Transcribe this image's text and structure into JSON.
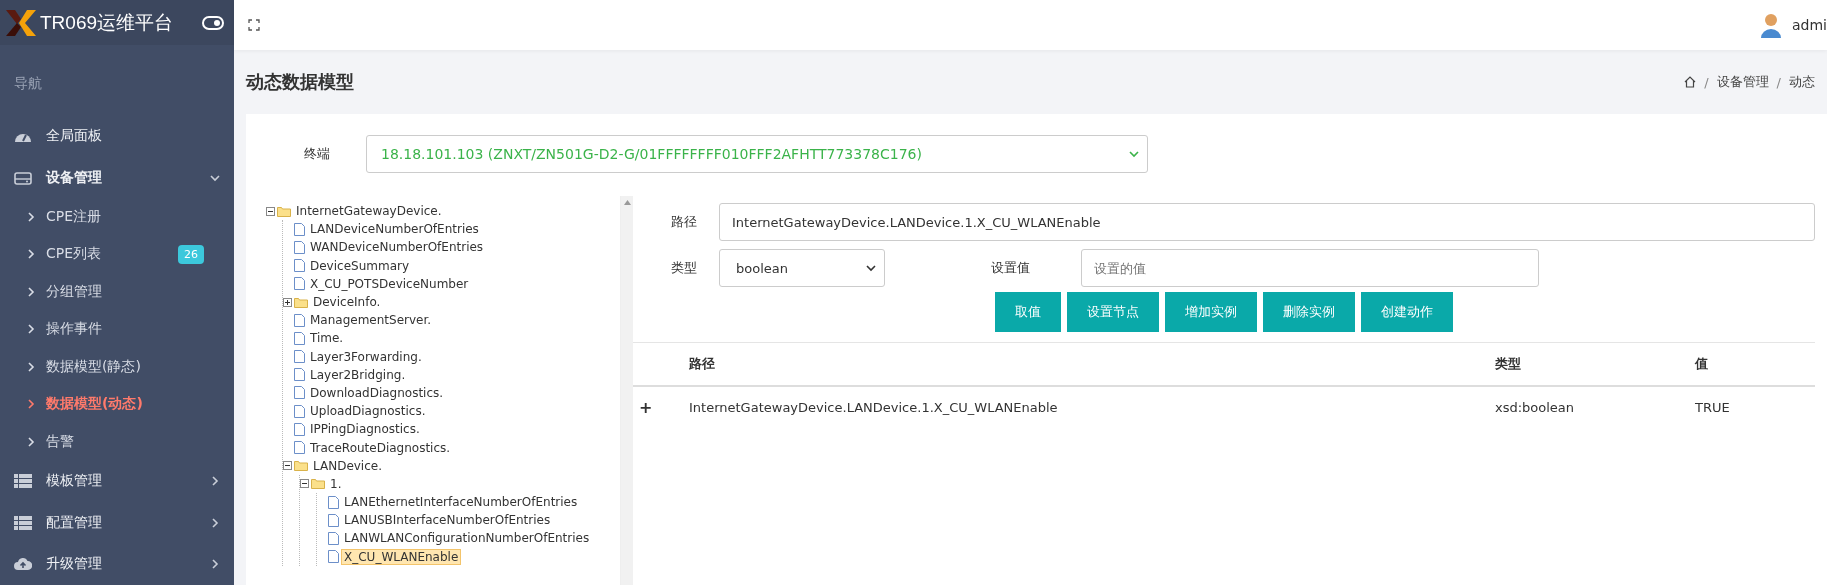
{
  "brand": {
    "title": "TR069运维平台"
  },
  "sidebar": {
    "heading": "导航",
    "items": [
      {
        "label": "全局面板",
        "expanded": false
      },
      {
        "label": "设备管理",
        "expanded": true,
        "children": [
          {
            "label": "CPE注册",
            "selected": false
          },
          {
            "label": "CPE列表",
            "selected": false,
            "badge": "26"
          },
          {
            "label": "分组管理",
            "selected": false
          },
          {
            "label": "操作事件",
            "selected": false
          },
          {
            "label": "数据模型(静态)",
            "selected": false
          },
          {
            "label": "数据模型(动态)",
            "selected": true
          },
          {
            "label": "告警",
            "selected": false
          }
        ]
      },
      {
        "label": "模板管理",
        "expanded": false
      },
      {
        "label": "配置管理",
        "expanded": false
      },
      {
        "label": "升级管理",
        "expanded": false
      }
    ]
  },
  "header": {
    "user": "admi"
  },
  "page": {
    "title": "动态数据模型",
    "breadcrumb_separator": "/",
    "breadcrumb": [
      "设备管理",
      "动态"
    ]
  },
  "terminal": {
    "label": "终端",
    "value": "18.18.101.103 (ZNXT/ZN501G-D2-G/01FFFFFFFF010FFF2AFHTT773378C176)"
  },
  "tree": [
    {
      "label": "InternetGatewayDevice.",
      "kind": "folder",
      "expanded": true,
      "selected": false,
      "children": [
        {
          "label": "LANDeviceNumberOfEntries",
          "kind": "file",
          "selected": false
        },
        {
          "label": "WANDeviceNumberOfEntries",
          "kind": "file",
          "selected": false
        },
        {
          "label": "DeviceSummary",
          "kind": "file",
          "selected": false
        },
        {
          "label": "X_CU_POTSDeviceNumber",
          "kind": "file",
          "selected": false
        },
        {
          "label": "DeviceInfo.",
          "kind": "folder",
          "expanded": false,
          "selected": false
        },
        {
          "label": "ManagementServer.",
          "kind": "file",
          "selected": false
        },
        {
          "label": "Time.",
          "kind": "file",
          "selected": false
        },
        {
          "label": "Layer3Forwarding.",
          "kind": "file",
          "selected": false
        },
        {
          "label": "Layer2Bridging.",
          "kind": "file",
          "selected": false
        },
        {
          "label": "DownloadDiagnostics.",
          "kind": "file",
          "selected": false
        },
        {
          "label": "UploadDiagnostics.",
          "kind": "file",
          "selected": false
        },
        {
          "label": "IPPingDiagnostics.",
          "kind": "file",
          "selected": false
        },
        {
          "label": "TraceRouteDiagnostics.",
          "kind": "file",
          "selected": false
        },
        {
          "label": "LANDevice.",
          "kind": "folder",
          "expanded": true,
          "selected": false,
          "children": [
            {
              "label": "1.",
              "kind": "folder",
              "expanded": true,
              "selected": false,
              "children": [
                {
                  "label": "LANEthernetInterfaceNumberOfEntries",
                  "kind": "file",
                  "selected": false
                },
                {
                  "label": "LANUSBInterfaceNumberOfEntries",
                  "kind": "file",
                  "selected": false
                },
                {
                  "label": "LANWLANConfigurationNumberOfEntries",
                  "kind": "file",
                  "selected": false
                },
                {
                  "label": "X_CU_WLANEnable",
                  "kind": "file",
                  "selected": true
                }
              ]
            }
          ]
        }
      ]
    }
  ],
  "form": {
    "path_label": "路径",
    "path_value": "InternetGatewayDevice.LANDevice.1.X_CU_WLANEnable",
    "type_label": "类型",
    "type_value": "boolean",
    "set_label": "设置值",
    "set_placeholder": "设置的值"
  },
  "buttons": [
    "取值",
    "设置节点",
    "增加实例",
    "删除实例",
    "创建动作"
  ],
  "table": {
    "columns": [
      "路径",
      "类型",
      "值"
    ],
    "rows": [
      {
        "expander": "+",
        "cells": [
          "InternetGatewayDevice.LANDevice.1.X_CU_WLANEnable",
          "xsd:boolean",
          "TRUE"
        ]
      }
    ]
  }
}
